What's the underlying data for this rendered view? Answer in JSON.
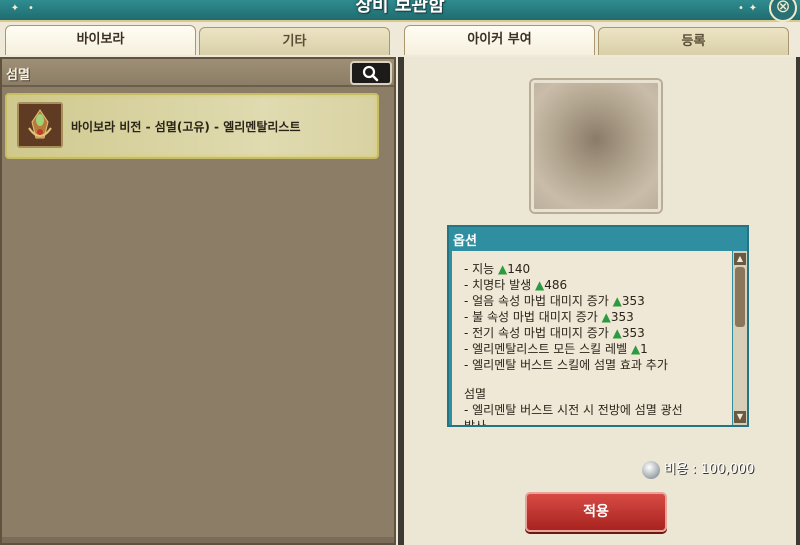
{
  "window": {
    "title": "장비 보관함"
  },
  "tabs_left": [
    {
      "label": "바이보라",
      "active": true
    },
    {
      "label": "기타",
      "active": false
    }
  ],
  "tabs_right": [
    {
      "label": "아이커 부여",
      "active": true
    },
    {
      "label": "등록",
      "active": false
    }
  ],
  "search": {
    "text": "섬멸"
  },
  "list": {
    "items": [
      {
        "name": "바이보라 비전 - 섬멸(고유) - 엘리멘탈리스트",
        "selected": true
      }
    ]
  },
  "options": {
    "header": "옵션",
    "lines": [
      {
        "text": "- 지능 ",
        "value": "140"
      },
      {
        "text": "- 치명타 발생 ",
        "value": "486"
      },
      {
        "text": "- 얼음 속성 마법 대미지 증가 ",
        "value": "353"
      },
      {
        "text": "- 불 속성 마법 대미지 증가 ",
        "value": "353"
      },
      {
        "text": "- 전기 속성 마법 대미지 증가 ",
        "value": "353"
      },
      {
        "text": "- 엘리멘탈리스트 모든 스킬 레벨 ",
        "value": "1"
      },
      {
        "text": "- 엘리멘탈 버스트 스킬에 섬멸 효과 추가",
        "value": ""
      }
    ],
    "section_title": "섬멸",
    "section_lines": [
      "- 엘리멘탈 버스트 시전 시 전방에 섬멸 광선",
      "발사"
    ],
    "up_symbol": "▲"
  },
  "cost": {
    "label": "비용 : 100,000"
  },
  "apply": {
    "label": "적용"
  },
  "colors": {
    "title_bar": "#2f8c8f",
    "apply_button": "#c8352f",
    "up_triangle": "#2d9a3f",
    "options_header": "#2f8fa0"
  },
  "icons": {
    "search": "magnifier-icon",
    "close": "close-icon",
    "item": "emblem-icon",
    "coin": "coin-icon"
  }
}
